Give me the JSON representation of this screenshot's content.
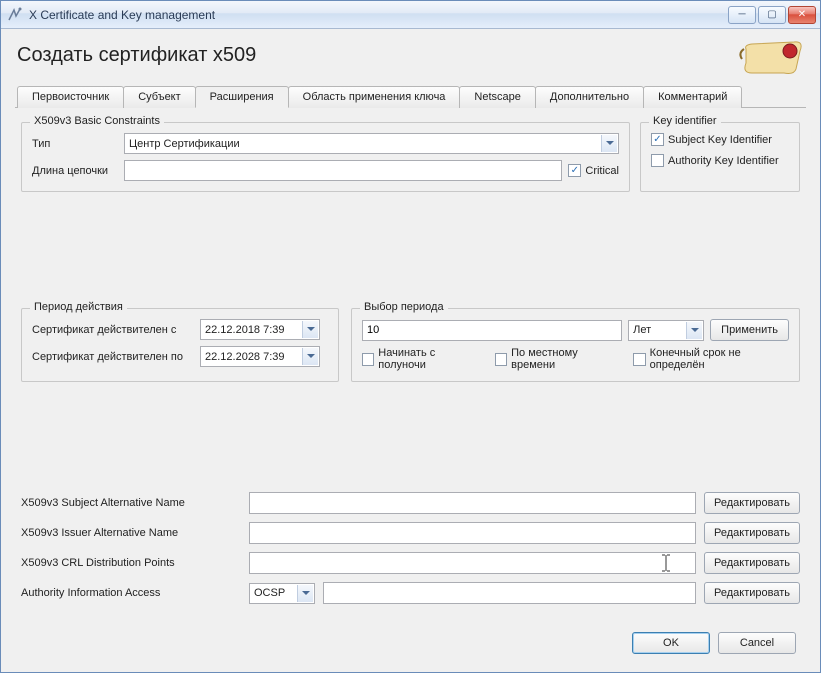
{
  "window": {
    "title": "X Certificate and Key management"
  },
  "page": {
    "title": "Создать сертификат x509"
  },
  "tabs": {
    "items": [
      {
        "label": "Первоисточник"
      },
      {
        "label": "Субъект"
      },
      {
        "label": "Расширения"
      },
      {
        "label": "Область применения ключа"
      },
      {
        "label": "Netscape"
      },
      {
        "label": "Дополнительно"
      },
      {
        "label": "Комментарий"
      }
    ],
    "active_index": 2
  },
  "basic_constraints": {
    "legend": "X509v3 Basic Constraints",
    "type_label": "Тип",
    "type_value": "Центр Сертификации",
    "pathlen_label": "Длина цепочки",
    "pathlen_value": "",
    "critical_label": "Critical",
    "critical_checked": true
  },
  "key_identifier": {
    "legend": "Key identifier",
    "subject_label": "Subject Key Identifier",
    "subject_checked": true,
    "authority_label": "Authority Key Identifier",
    "authority_checked": false
  },
  "validity": {
    "legend": "Период действия",
    "from_label": "Сертификат действителен с",
    "from_value": "22.12.2018 7:39",
    "to_label": "Сертификат действителен по",
    "to_value": "22.12.2028 7:39"
  },
  "time_range": {
    "legend": "Выбор периода",
    "value": "10",
    "unit": "Лет",
    "apply_label": "Применить",
    "midnight_label": "Начинать с полуночи",
    "midnight_checked": false,
    "localtime_label": "По местному времени",
    "localtime_checked": false,
    "no_expiry_label": "Конечный срок не определён",
    "no_expiry_checked": false
  },
  "extensions": {
    "san_label": "X509v3 Subject Alternative Name",
    "san_value": "",
    "ian_label": "X509v3 Issuer Alternative Name",
    "ian_value": "",
    "crl_label": "X509v3 CRL Distribution Points",
    "crl_value": "",
    "aia_label": "Authority Information Access",
    "aia_kind": "OCSP",
    "aia_value": "",
    "edit_label": "Редактировать"
  },
  "footer": {
    "ok": "OK",
    "cancel": "Cancel"
  }
}
